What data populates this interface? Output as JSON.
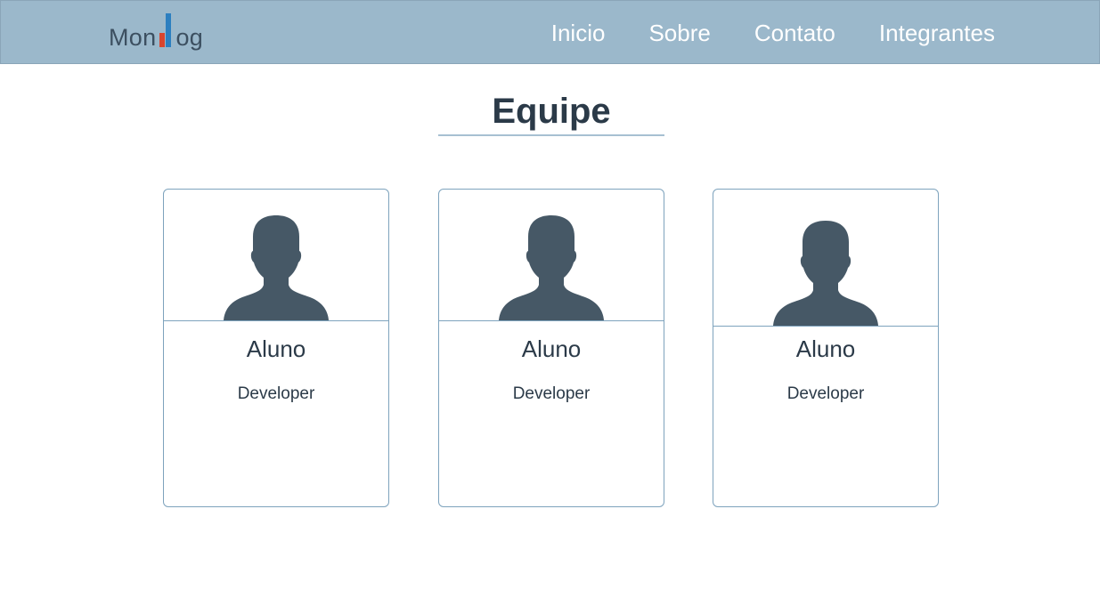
{
  "header": {
    "logo": {
      "text_left": "Mon",
      "text_right": "og",
      "brand_colors": {
        "red_bar": "#d9452e",
        "blue_bar": "#2c7fc0",
        "text": "#3c4f60"
      }
    },
    "nav": [
      {
        "label": "Inicio"
      },
      {
        "label": "Sobre"
      },
      {
        "label": "Contato"
      },
      {
        "label": "Integrantes"
      }
    ],
    "background_color": "#9bb8cb"
  },
  "main": {
    "title": "Equipe",
    "cards": [
      {
        "name": "Aluno",
        "role": "Developer",
        "avatar_icon": "person-silhouette-icon"
      },
      {
        "name": "Aluno",
        "role": "Developer",
        "avatar_icon": "person-silhouette-icon"
      },
      {
        "name": "Aluno",
        "role": "Developer",
        "avatar_icon": "person-silhouette-icon"
      }
    ],
    "avatar_color": "#465866"
  }
}
